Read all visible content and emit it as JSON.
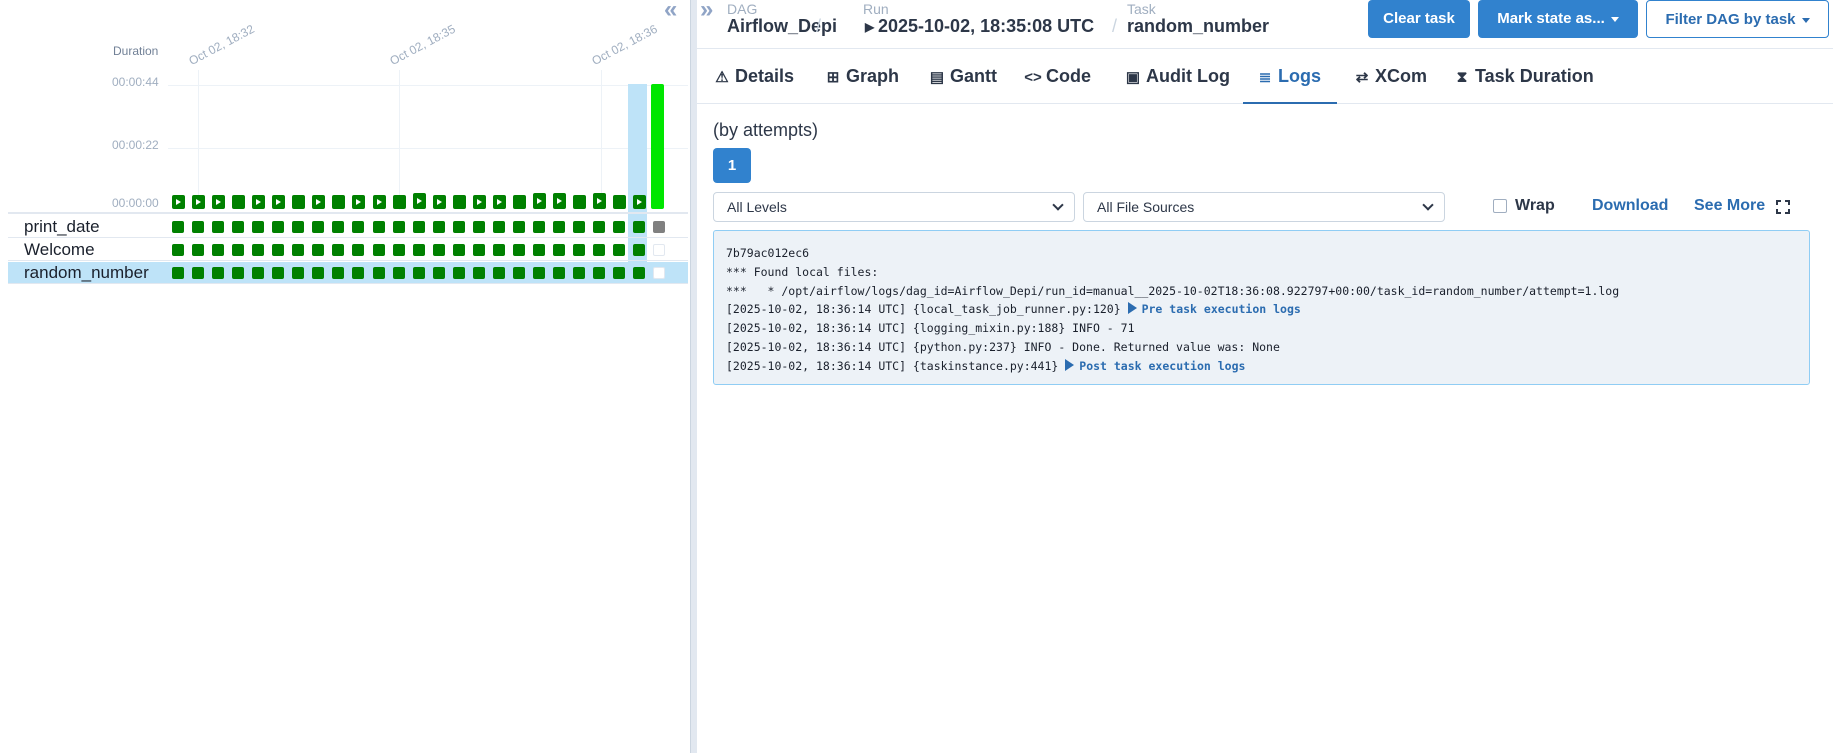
{
  "grid": {
    "duration_label": "Duration",
    "date_labels": [
      "Oct 02, 18:32",
      "Oct 02, 18:35",
      "Oct 02, 18:36"
    ],
    "ticks": [
      "00:00:44",
      "00:00:22",
      "00:00:00"
    ],
    "tasks": [
      {
        "name": "print_date",
        "last_state": "grey"
      },
      {
        "name": "Welcome",
        "last_state": "empty"
      },
      {
        "name": "random_number",
        "last_state": "empty"
      }
    ],
    "status_color": "#008000",
    "selected_run_color": "#00e600"
  },
  "breadcrumb": {
    "dag_label": "DAG",
    "dag_value": "Airflow_Depi",
    "run_label": "Run",
    "run_value": "2025-10-02, 18:35:08 UTC",
    "task_label": "Task",
    "task_value": "random_number"
  },
  "actions": {
    "clear": "Clear task",
    "mark": "Mark state as...",
    "filter": "Filter DAG by task"
  },
  "tabs": [
    {
      "label": "Details",
      "icon": "warning-icon"
    },
    {
      "label": "Graph",
      "icon": "graph-icon"
    },
    {
      "label": "Gantt",
      "icon": "gantt-icon"
    },
    {
      "label": "Code",
      "icon": "code-icon"
    },
    {
      "label": "Audit Log",
      "icon": "audit-log-icon"
    },
    {
      "label": "Logs",
      "icon": "logs-icon",
      "active": true
    },
    {
      "label": "XCom",
      "icon": "xcom-icon"
    },
    {
      "label": "Task Duration",
      "icon": "hourglass-icon"
    }
  ],
  "logs": {
    "attempts_label": "(by attempts)",
    "attempt": "1",
    "levels": "All Levels",
    "sources": "All File Sources",
    "wrap": "Wrap",
    "download": "Download",
    "see_more": "See More",
    "lines": [
      "7b79ac012ec6",
      "*** Found local files:",
      "***   * /opt/airflow/logs/dag_id=Airflow_Depi/run_id=manual__2025-10-02T18:36:08.922797+00:00/task_id=random_number/attempt=1.log",
      "[2025-10-02, 18:36:14 UTC] {local_task_job_runner.py:120} ",
      "[2025-10-02, 18:36:14 UTC] {logging_mixin.py:188} INFO - 71",
      "[2025-10-02, 18:36:14 UTC] {python.py:237} INFO - Done. Returned value was: None",
      "[2025-10-02, 18:36:14 UTC] {taskinstance.py:441} "
    ],
    "pre_link": "Pre task execution logs",
    "post_link": "Post task execution logs"
  }
}
